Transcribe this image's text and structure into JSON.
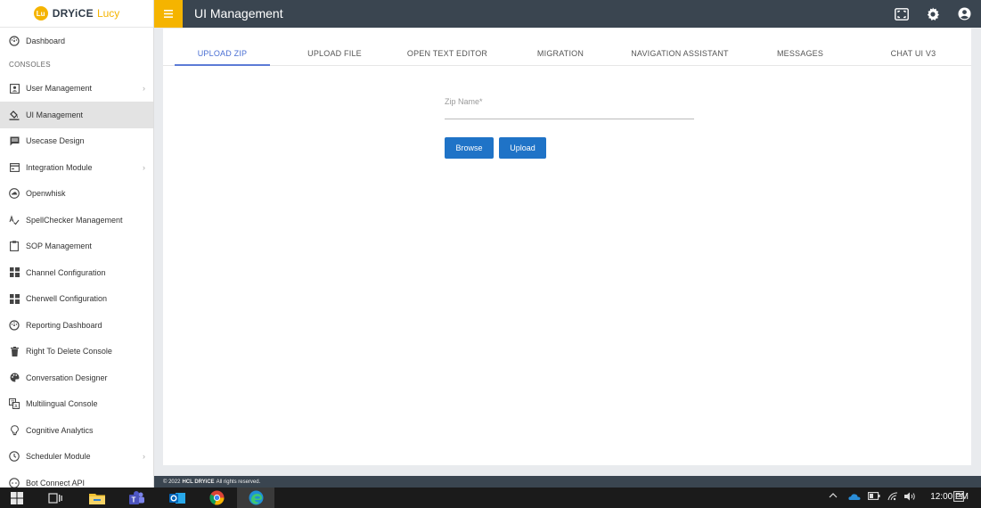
{
  "brand": {
    "badge": "Lu",
    "name": "DRYiCE",
    "product": "Lucy"
  },
  "header": {
    "title": "UI Management",
    "menu_icon": "menu-icon"
  },
  "sidebar": {
    "dashboard": "Dashboard",
    "section": "CONSOLES",
    "items": [
      {
        "label": "User Management",
        "icon": "user-icon",
        "chevron": true
      },
      {
        "label": "UI Management",
        "icon": "paint-bucket-icon",
        "active": true
      },
      {
        "label": "Usecase Design",
        "icon": "message-icon"
      },
      {
        "label": "Integration Module",
        "icon": "card-icon",
        "chevron": true
      },
      {
        "label": "Openwhisk",
        "icon": "cloud-icon"
      },
      {
        "label": "SpellChecker Management",
        "icon": "spellcheck-icon"
      },
      {
        "label": "SOP Management",
        "icon": "clipboard-icon"
      },
      {
        "label": "Channel Configuration",
        "icon": "grid-icon"
      },
      {
        "label": "Cherwell Configuration",
        "icon": "grid-icon"
      },
      {
        "label": "Reporting Dashboard",
        "icon": "dashboard-icon"
      },
      {
        "label": "Right To Delete Console",
        "icon": "trash-icon"
      },
      {
        "label": "Conversation Designer",
        "icon": "palette-icon"
      },
      {
        "label": "Multilingual Console",
        "icon": "translate-icon"
      },
      {
        "label": "Cognitive Analytics",
        "icon": "bulb-icon"
      },
      {
        "label": "Scheduler Module",
        "icon": "clock-icon",
        "chevron": true
      },
      {
        "label": "Bot Connect API",
        "icon": "api-icon"
      }
    ]
  },
  "tabs": [
    {
      "label": "UPLOAD ZIP",
      "active": true
    },
    {
      "label": "UPLOAD FILE"
    },
    {
      "label": "OPEN TEXT EDITOR"
    },
    {
      "label": "MIGRATION"
    },
    {
      "label": "NAVIGATION ASSISTANT"
    },
    {
      "label": "MESSAGES"
    },
    {
      "label": "CHAT UI V3"
    }
  ],
  "form": {
    "zip_label": "Zip Name*",
    "zip_value": "",
    "browse_label": "Browse",
    "upload_label": "Upload"
  },
  "footer": {
    "prefix": "© 2022",
    "company": "HCL DRYiCE",
    "suffix": "All rights reserved."
  },
  "taskbar": {
    "time": "12:00 PM"
  },
  "colors": {
    "accent": "#f5b400",
    "header": "#3a4550",
    "primary_button": "#1f73c7",
    "tab_active": "#4a6fd3"
  }
}
